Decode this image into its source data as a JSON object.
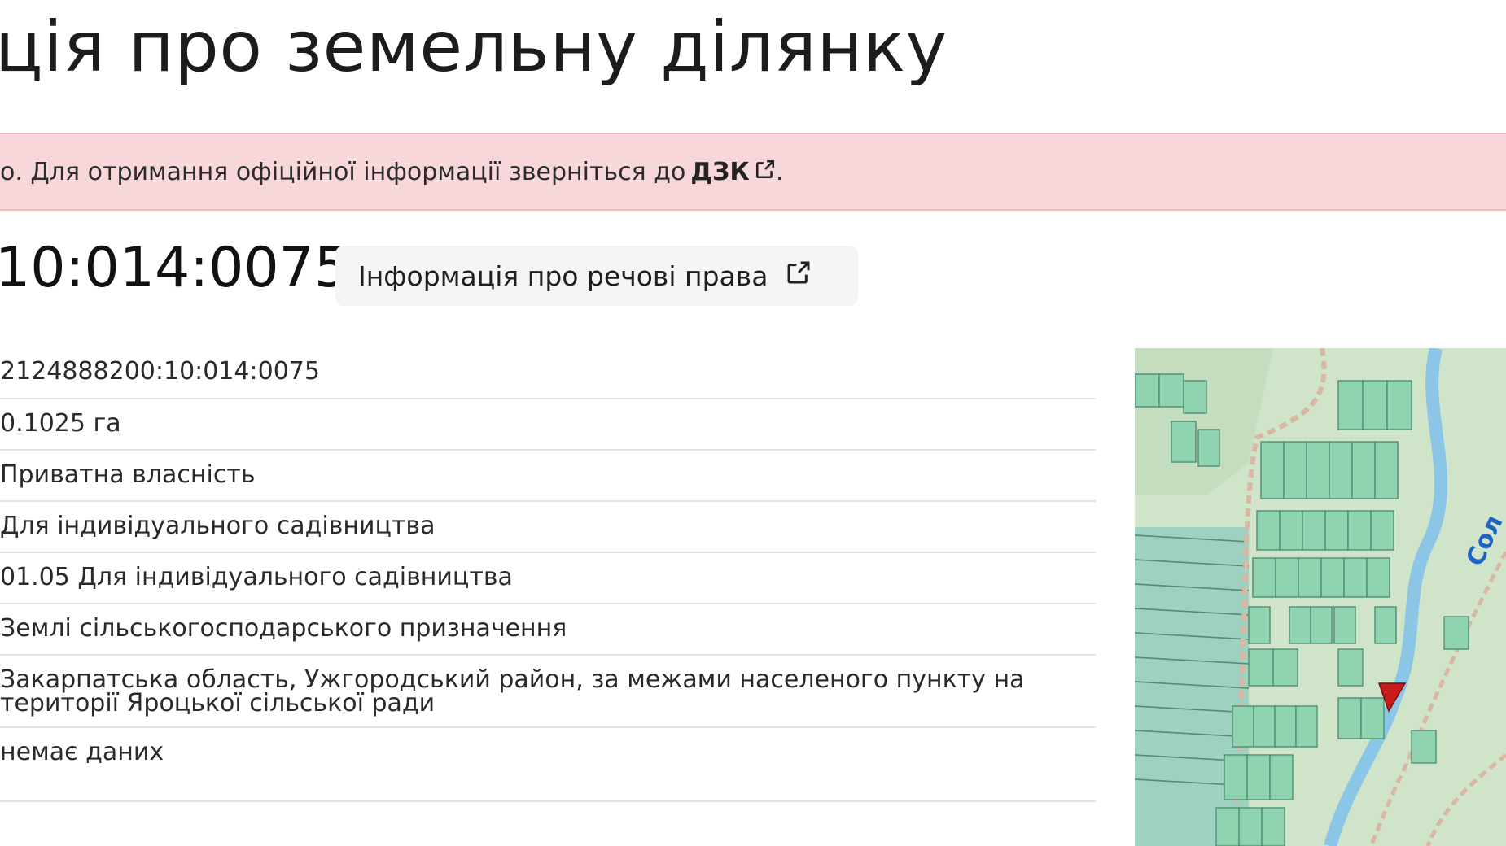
{
  "page": {
    "title": "ція про земельну ділянку"
  },
  "alert": {
    "text": "о. Для отримання офіційної інформації зверніться до",
    "link_label": "ДЗК",
    "suffix": ".",
    "link_icon": "external-link-icon"
  },
  "parcel": {
    "cadastral_number_partial": "10:014:0075",
    "rights_button_label": "Інформація про речові права",
    "rights_button_icon": "external-link-icon"
  },
  "details": {
    "rows": [
      "2124888200:10:014:0075",
      "0.1025 га",
      "Приватна власність",
      "Для індивідуального садівництва",
      "01.05 Для індивідуального садівництва",
      "Землі сільськогосподарського призначення",
      "Закарпатська область, Ужгородський район, за межами населеного пункту на території Яроцької сільської ради",
      "немає даних",
      ""
    ]
  },
  "map": {
    "road_label": "Сол",
    "colors": {
      "background": "#cfe4c8",
      "forest": "#b9d7b1",
      "parcel_fill": "#8fd3b0",
      "parcel_stroke": "#4f8f73",
      "selected_parcel": "#c81c1c",
      "river": "#8cc6e6",
      "road": "#d9b7a3",
      "road_label": "#1e63c8"
    }
  }
}
